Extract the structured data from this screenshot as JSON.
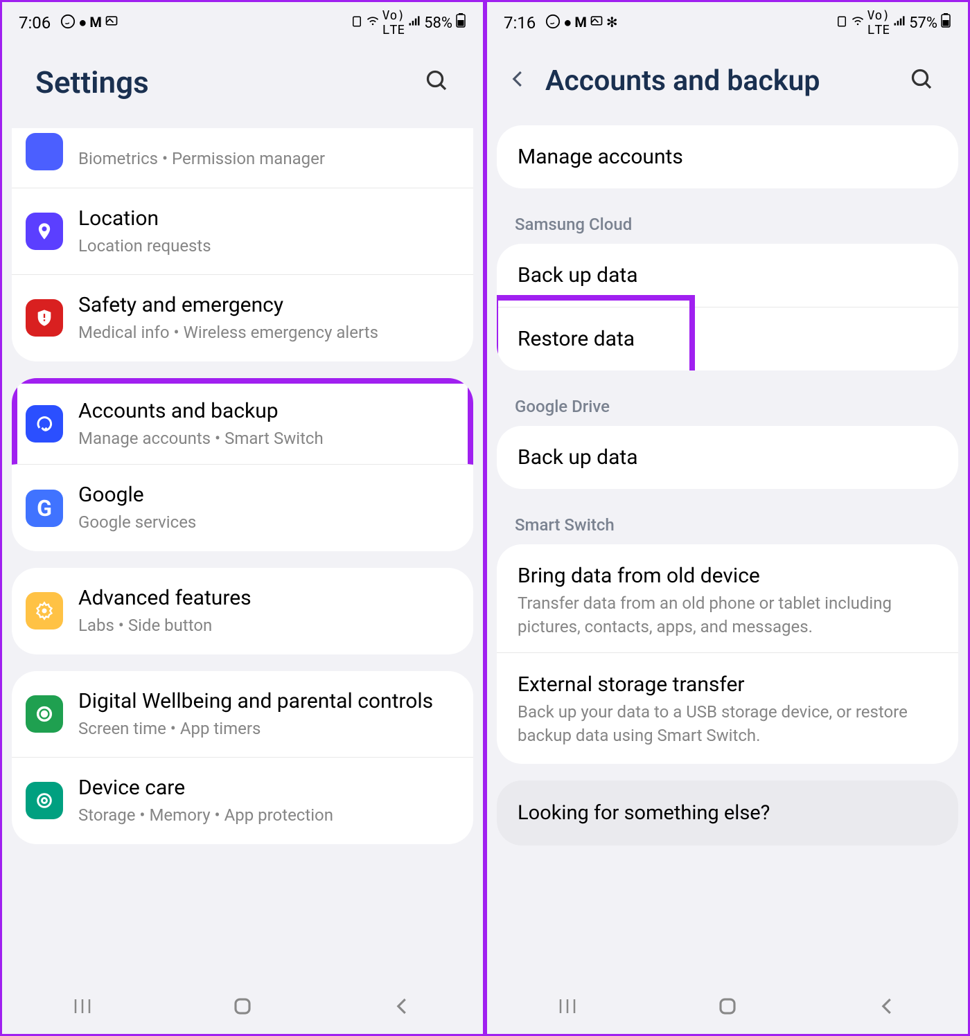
{
  "left": {
    "status": {
      "time": "7:06",
      "battery": "58%"
    },
    "header": {
      "title": "Settings"
    },
    "partial": {
      "subtitle": "Biometrics  •  Permission manager"
    },
    "items1": [
      {
        "title": "Location",
        "subtitle": "Location requests"
      },
      {
        "title": "Safety and emergency",
        "subtitle": "Medical info  •  Wireless emergency alerts"
      }
    ],
    "items2": [
      {
        "title": "Accounts and backup",
        "subtitle": "Manage accounts  •  Smart Switch",
        "highlight": true
      },
      {
        "title": "Google",
        "subtitle": "Google services"
      }
    ],
    "items3": [
      {
        "title": "Advanced features",
        "subtitle": "Labs  •  Side button"
      }
    ],
    "items4": [
      {
        "title": "Digital Wellbeing and parental controls",
        "subtitle": "Screen time  •  App timers"
      },
      {
        "title": "Device care",
        "subtitle": "Storage  •  Memory  •  App protection"
      }
    ]
  },
  "right": {
    "status": {
      "time": "7:16",
      "battery": "57%"
    },
    "header": {
      "title": "Accounts and backup"
    },
    "top": {
      "manage": "Manage accounts"
    },
    "sc": {
      "header": "Samsung Cloud",
      "backup": "Back up data",
      "restore": "Restore data"
    },
    "gd": {
      "header": "Google Drive",
      "backup": "Back up data"
    },
    "ss": {
      "header": "Smart Switch",
      "bring_title": "Bring data from old device",
      "bring_desc": "Transfer data from an old phone or tablet including pictures, contacts, apps, and messages.",
      "ext_title": "External storage transfer",
      "ext_desc": "Back up your data to a USB storage device, or restore backup data using Smart Switch."
    },
    "looking": "Looking for something else?"
  }
}
